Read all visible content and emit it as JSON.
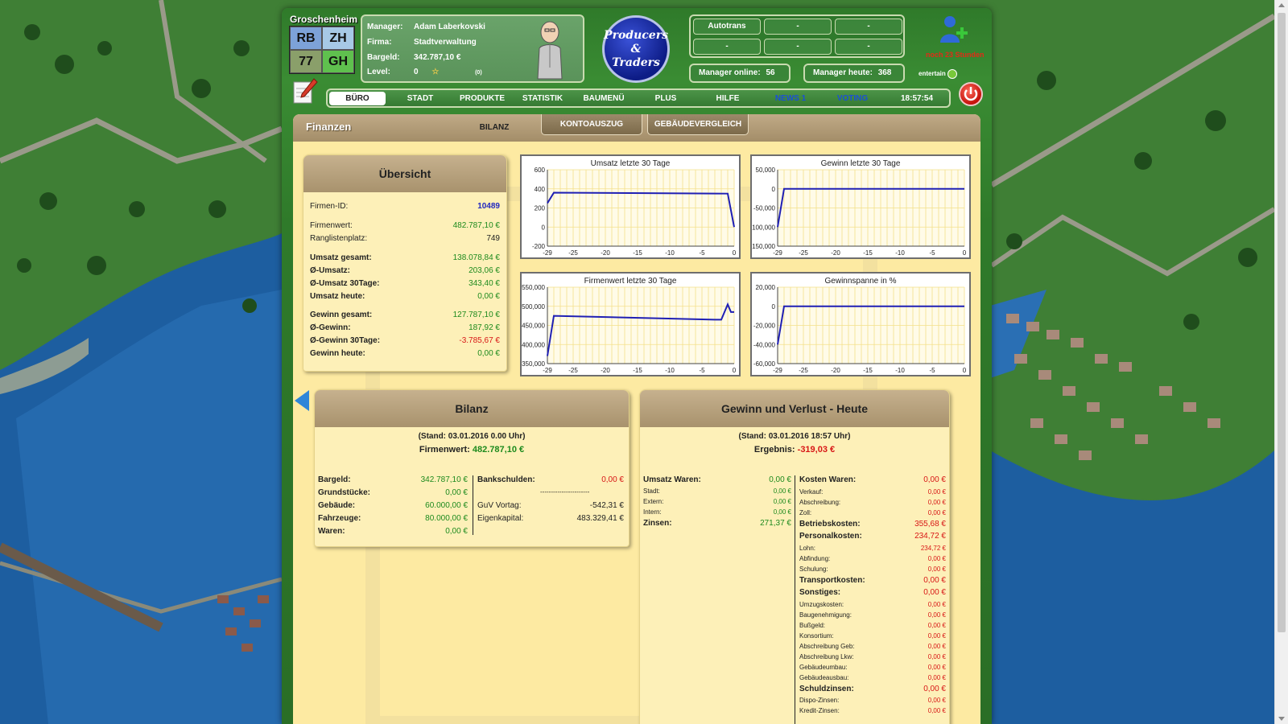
{
  "header": {
    "city": "Groschenheim",
    "city_cells": [
      "RB",
      "ZH",
      "77",
      "GH"
    ],
    "manager": {
      "labels": [
        "Manager:",
        "Firma:",
        "Bargeld:",
        "Level:"
      ],
      "values": [
        "Adam Laberkovski",
        "Stadtverwaltung",
        "342.787,10 €",
        "0"
      ],
      "extra": "(0)"
    },
    "logo": [
      "Producers",
      "&",
      "Traders"
    ],
    "slots": [
      "Autotrans",
      "-",
      "-",
      "-",
      "-",
      "-"
    ],
    "manager_online_label": "Manager online:",
    "manager_online": "56",
    "manager_today_label": "Manager heute:",
    "manager_today": "368",
    "add_user_note": "noch 23 Stunden",
    "entertain": "entertain"
  },
  "nav": {
    "items": [
      "BÜRO",
      "STADT",
      "PRODUKTE",
      "STATISTIK",
      "BAUMENÜ",
      "PLUS",
      "HILFE",
      "NEWS 1",
      "VOTING"
    ],
    "time": "18:57:54"
  },
  "page": {
    "title": "Finanzen",
    "tabs": [
      "BILANZ",
      "KONTOAUSZUG",
      "GEBÄUDEVERGLEICH"
    ]
  },
  "overview": {
    "title": "Übersicht",
    "rows": [
      {
        "k": "Firmen-ID:",
        "v": "10489"
      },
      {
        "k": "Firmenwert:",
        "v": "482.787,10 €"
      },
      {
        "k": "Ranglistenplatz:",
        "v": "749"
      },
      {
        "k": "Umsatz gesamt:",
        "v": "138.078,84 €"
      },
      {
        "k": "Ø-Umsatz:",
        "v": "203,06 €"
      },
      {
        "k": "Ø-Umsatz 30Tage:",
        "v": "343,40 €"
      },
      {
        "k": "Umsatz heute:",
        "v": "0,00 €"
      },
      {
        "k": "Gewinn gesamt:",
        "v": "127.787,10 €"
      },
      {
        "k": "Ø-Gewinn:",
        "v": "187,92 €"
      },
      {
        "k": "Ø-Gewinn 30Tage:",
        "v": "-3.785,67 €"
      },
      {
        "k": "Gewinn heute:",
        "v": "0,00 €"
      }
    ]
  },
  "chart_data": [
    {
      "type": "line",
      "title": "Umsatz letzte 30 Tage",
      "x": [
        -29,
        -28,
        -1,
        0
      ],
      "y": [
        250,
        360,
        350,
        0
      ],
      "ylim": [
        -200,
        600
      ],
      "yticks": [
        "600",
        "400",
        "200",
        "0",
        "-200"
      ],
      "xticks": [
        "-29",
        "-25",
        "-20",
        "-15",
        "-10",
        "-5",
        "0"
      ],
      "color": "#1f1fb4"
    },
    {
      "type": "line",
      "title": "Gewinn letzte 30 Tage",
      "x": [
        -29,
        -28,
        0
      ],
      "y": [
        -100000,
        0,
        0
      ],
      "ylim": [
        -150000,
        50000
      ],
      "yticks": [
        "50,000",
        "0",
        "-50,000",
        "-100,000",
        "-150,000"
      ],
      "xticks": [
        "-29",
        "-25",
        "-20",
        "-15",
        "-10",
        "-5",
        "0"
      ],
      "color": "#1f1fb4"
    },
    {
      "type": "line",
      "title": "Firmenwert letzte 30 Tage",
      "x": [
        -29,
        -28,
        -3,
        -2,
        -1,
        -0.5,
        0
      ],
      "y": [
        370000,
        475000,
        465000,
        465000,
        505000,
        485000,
        485000
      ],
      "ylim": [
        350000,
        550000
      ],
      "yticks": [
        "550,000",
        "500,000",
        "450,000",
        "400,000",
        "350,000"
      ],
      "xticks": [
        "-29",
        "-25",
        "-20",
        "-15",
        "-10",
        "-5",
        "0"
      ],
      "color": "#1f1fb4"
    },
    {
      "type": "line",
      "title": "Gewinnspanne in %",
      "x": [
        -29,
        -28,
        0
      ],
      "y": [
        -40000,
        0,
        0
      ],
      "ylim": [
        -60000,
        20000
      ],
      "yticks": [
        "20,000",
        "0",
        "-20,000",
        "-40,000",
        "-60,000"
      ],
      "xticks": [
        "-29",
        "-25",
        "-20",
        "-15",
        "-10",
        "-5",
        "0"
      ],
      "color": "#1f1fb4"
    }
  ],
  "bilanz": {
    "title": "Bilanz",
    "stand": "(Stand: 03.01.2016 0.00 Uhr)",
    "firmenwert_label": "Firmenwert:",
    "firmenwert": "482.787,10 €",
    "left": [
      {
        "k": "Bargeld:",
        "v": "342.787,10 €"
      },
      {
        "k": "Grundstücke:",
        "v": "0,00 €"
      },
      {
        "k": "Gebäude:",
        "v": "60.000,00 €"
      },
      {
        "k": "Fahrzeuge:",
        "v": "80.000,00 €"
      },
      {
        "k": "Waren:",
        "v": "0,00 €"
      }
    ],
    "right": [
      {
        "k": "Bankschulden:",
        "v": "0,00 €"
      },
      {
        "k": "GuV Vortag:",
        "v": "-542,31 €"
      },
      {
        "k": "Eigenkapital:",
        "v": "483.329,41 €"
      }
    ],
    "divider": "-----------------------"
  },
  "guv": {
    "title": "Gewinn und Verlust - Heute",
    "stand": "(Stand: 03.01.2016 18:57 Uhr)",
    "ergebnis_label": "Ergebnis:",
    "ergebnis": "-319,03 €",
    "left": [
      {
        "k": "Umsatz Waren:",
        "v": "0,00 €",
        "main": true
      },
      {
        "k": "Stadt:",
        "v": "0,00 €"
      },
      {
        "k": "Extern:",
        "v": "0,00 €"
      },
      {
        "k": "Intern:",
        "v": "0,00 €"
      },
      {
        "k": "Zinsen:",
        "v": "271,37 €",
        "main": true
      }
    ],
    "right": [
      {
        "k": "Kosten Waren:",
        "v": "0,00 €",
        "main": true
      },
      {
        "k": "Verkauf:",
        "v": "0,00 €"
      },
      {
        "k": "Abschreibung:",
        "v": "0,00 €"
      },
      {
        "k": "Zoll:",
        "v": "0,00 €"
      },
      {
        "k": "Betriebskosten:",
        "v": "355,68 €",
        "main": true
      },
      {
        "k": "Personalkosten:",
        "v": "234,72 €",
        "main": true
      },
      {
        "k": "Lohn:",
        "v": "234,72 €"
      },
      {
        "k": "Abfindung:",
        "v": "0,00 €"
      },
      {
        "k": "Schulung:",
        "v": "0,00 €"
      },
      {
        "k": "Transportkosten:",
        "v": "0,00 €",
        "main": true
      },
      {
        "k": "Sonstiges:",
        "v": "0,00 €",
        "main": true
      },
      {
        "k": "Umzugskosten:",
        "v": "0,00 €"
      },
      {
        "k": "Baugenehmigung:",
        "v": "0,00 €"
      },
      {
        "k": "Bußgeld:",
        "v": "0,00 €"
      },
      {
        "k": "Konsortium:",
        "v": "0,00 €"
      },
      {
        "k": "Abschreibung Geb:",
        "v": "0,00 €"
      },
      {
        "k": "Abschreibung Lkw:",
        "v": "0,00 €"
      },
      {
        "k": "Gebäudeumbau:",
        "v": "0,00 €"
      },
      {
        "k": "Gebäudeausbau:",
        "v": "0,00 €"
      },
      {
        "k": "Schuldzinsen:",
        "v": "0,00 €",
        "main": true
      },
      {
        "k": "Dispo-Zinsen:",
        "v": "0,00 €"
      },
      {
        "k": "Kredit-Zinsen:",
        "v": "0,00 €"
      }
    ]
  }
}
